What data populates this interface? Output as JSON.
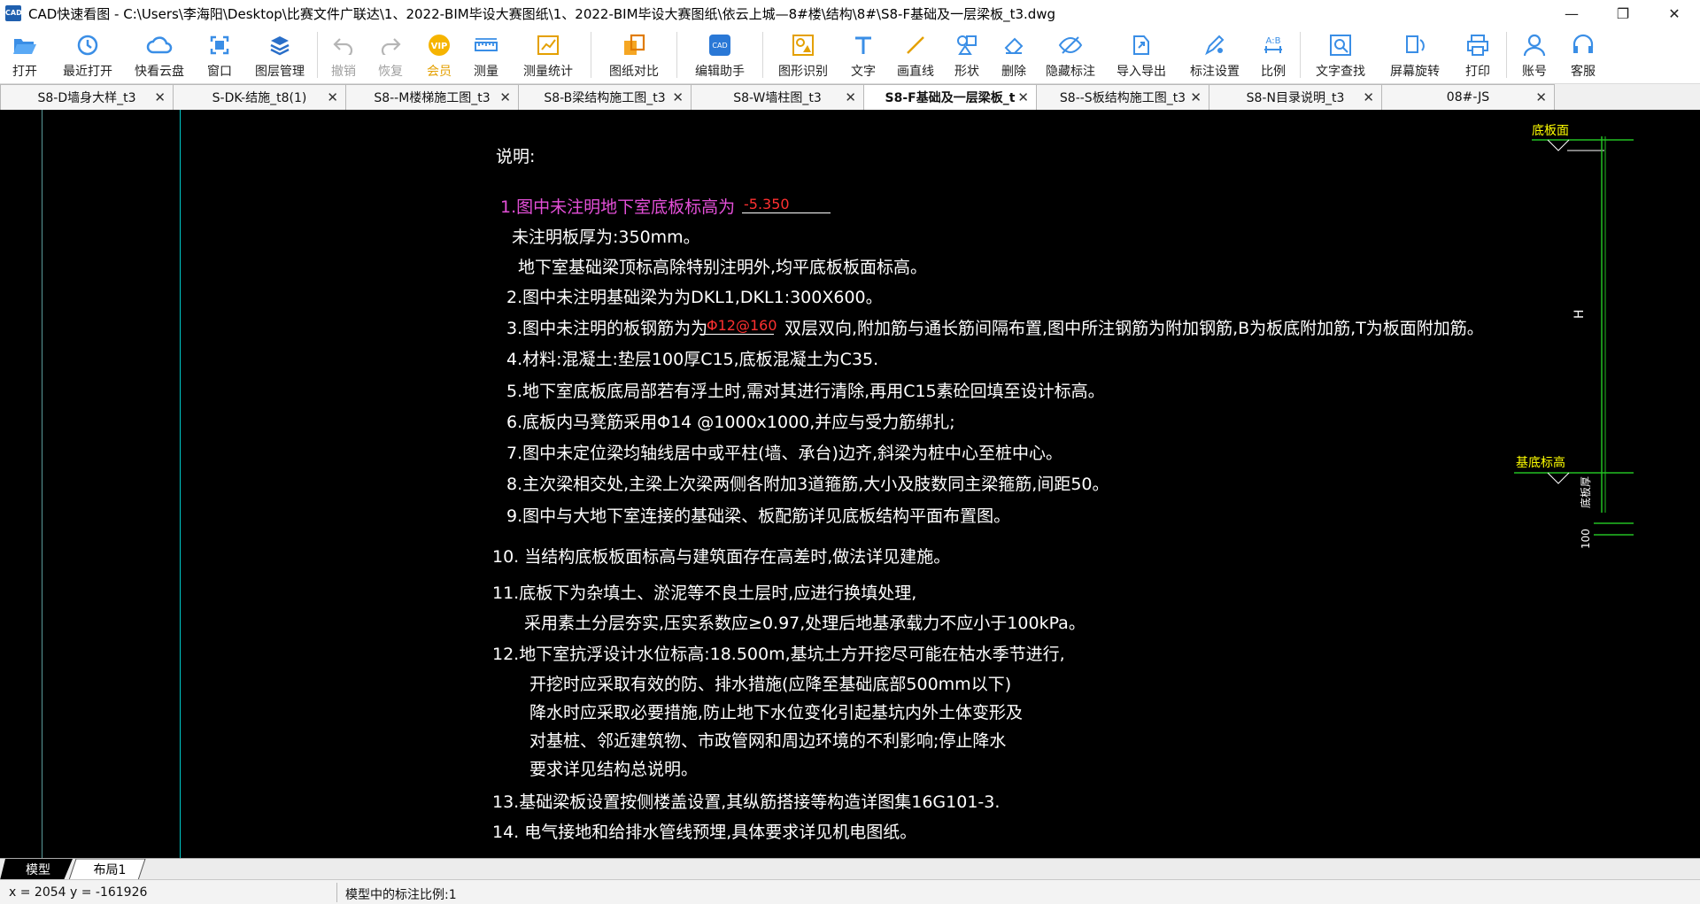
{
  "app": {
    "icon_text": "CAD",
    "title": "CAD快速看图 - C:\\Users\\李海阳\\Desktop\\比赛文件广联达\\1、2022-BIM毕设大赛图纸\\1、2022-BIM毕设大赛图纸\\依云上城—8#楼\\结构\\8#\\S8-F基础及一层梁板_t3.dwg"
  },
  "window_controls": {
    "minimize": "—",
    "maximize": "❐",
    "close": "✕"
  },
  "toolbar": {
    "open": "打开",
    "recent": "最近打开",
    "cloud": "快看云盘",
    "window": "窗口",
    "layers": "图层管理",
    "undo": "撤销",
    "redo": "恢复",
    "vip": "会员",
    "vip_badge": "VIP",
    "measure": "测量",
    "measure_stats": "测量统计",
    "compare": "图纸对比",
    "edit_helper": "编辑助手",
    "shape_recog": "图形识别",
    "text": "文字",
    "line": "画直线",
    "shape": "形状",
    "delete": "删除",
    "hide_annot": "隐藏标注",
    "import_export": "导入导出",
    "annot_settings": "标注设置",
    "ratio": "比例",
    "ratio_badge": "A:B",
    "find_text": "文字查找",
    "rotate": "屏幕旋转",
    "print": "打印",
    "account": "账号",
    "service": "客服"
  },
  "tabs": [
    {
      "label": "S8-D墙身大样_t3",
      "active": false
    },
    {
      "label": "S-DK-结施_t8(1)",
      "active": false
    },
    {
      "label": "S8--M楼梯施工图_t3",
      "active": false
    },
    {
      "label": "S8-B梁结构施工图_t3",
      "active": false
    },
    {
      "label": "S8-W墙柱图_t3",
      "active": false
    },
    {
      "label": "S8-F基础及一层梁板_t",
      "active": true
    },
    {
      "label": "S8--S板结构施工图_t3",
      "active": false
    },
    {
      "label": "S8-N目录说明_t3",
      "active": false
    },
    {
      "label": "08#-JS",
      "active": false
    }
  ],
  "tab_close_glyph": "✕",
  "notes": {
    "heading": "说明:",
    "n1": "1.图中未注明地下室底板标高为",
    "n1_value": "-5.350",
    "n1a": "未注明板厚为:350mm。",
    "n1b": "地下室基础梁顶标高除特别注明外,均平底板板面标高。",
    "n2": "2.图中未注明基础梁为为DKL1,DKL1:300X600。",
    "n3": "3.图中未注明的板钢筋为为",
    "n3_value": "Φ12@160",
    "n3b": "双层双向,附加筋与通长筋间隔布置,图中所注钢筋为附加钢筋,B为板底附加筋,T为板面附加筋。",
    "n4": "4.材料:混凝土:垫层100厚C15,底板混凝土为C35.",
    "n5": "5.地下室底板底局部若有浮土时,需对其进行清除,再用C15素砼回填至设计标高。",
    "n6": "6.底板内马凳筋采用Φ14 @1000x1000,并应与受力筋绑扎;",
    "n7": "7.图中未定位梁均轴线居中或平柱(墙、承台)边齐,斜梁为桩中心至桩中心。",
    "n8": "8.主次梁相交处,主梁上次梁两侧各附加3道箍筋,大小及肢数同主梁箍筋,间距50。",
    "n9": "9.图中与大地下室连接的基础梁、板配筋详见底板结构平面布置图。",
    "n10": "10. 当结构底板板面标高与建筑面存在高差时,做法详见建施。",
    "n11": "11.底板下为杂填土、淤泥等不良土层时,应进行换填处理,",
    "n11b": "采用素土分层夯实,压实系数应≥0.97,处理后地基承载力不应小于100kPa。",
    "n12": "12.地下室抗浮设计水位标高:18.500m,基坑土方开挖尽可能在枯水季节进行,",
    "n12b": "开挖时应采取有效的防、排水措施(应降至基础底部500mm以下)",
    "n12c": "降水时应采取必要措施,防止地下水位变化引起基坑内外土体变形及",
    "n12d": "对基桩、邻近建筑物、市政管网和周边环境的不利影响;停止降水",
    "n12e": "要求详见结构总说明。",
    "n13": "13.基础梁板设置按侧楼盖设置,其纵筋搭接等构造详图集16G101-3.",
    "n14": "14. 电气接地和给排水管线预埋,具体要求详见机电图纸。"
  },
  "elevation": {
    "top_label": "底板面",
    "mid_label": "基底标高",
    "h_label": "H",
    "bottom_label": "底板厚",
    "dim_label": "100"
  },
  "layouts": {
    "model": "模型",
    "layout1": "布局1"
  },
  "status": {
    "coords": "x = 2054  y = -161926",
    "scale": "模型中的标注比例:1"
  },
  "colors": {
    "canvas_bg": "#000000",
    "note_text": "#ffffff",
    "magenta": "#e44fd8",
    "highlight_red": "#ff3030",
    "elevation_green": "#22c022",
    "label_yellow": "#ffff00",
    "ruler_cyan": "#00c8c8"
  }
}
